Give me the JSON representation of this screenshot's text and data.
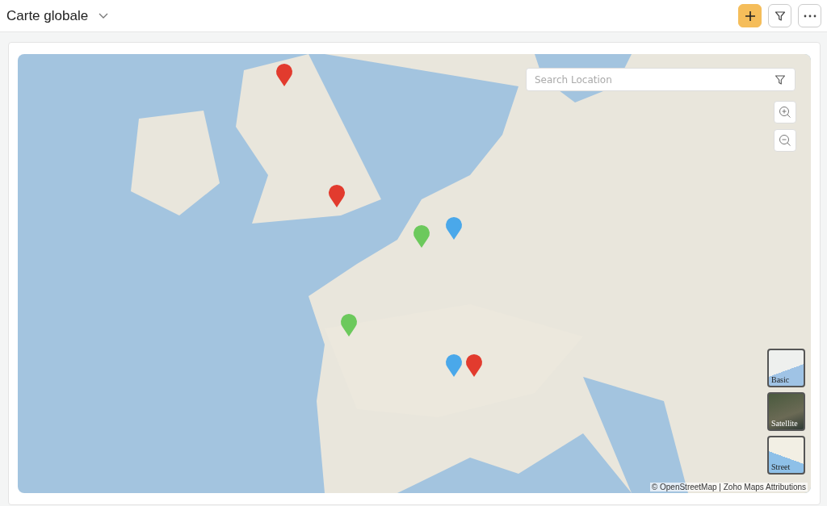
{
  "header": {
    "title": "Carte globale"
  },
  "map": {
    "search": {
      "placeholder": "Search Location"
    },
    "layers": [
      {
        "label": "Basic"
      },
      {
        "label": "Satellite"
      },
      {
        "label": "Street"
      }
    ],
    "attribution": "© OpenStreetMap | Zoho Maps Attributions"
  }
}
